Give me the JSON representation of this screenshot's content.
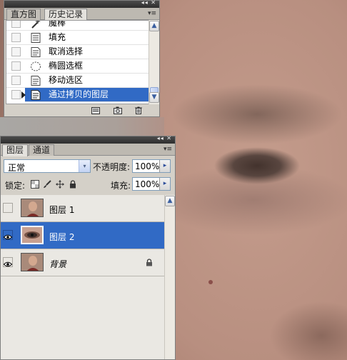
{
  "history_panel": {
    "tabs": [
      {
        "label": "直方图",
        "active": false
      },
      {
        "label": "历史记录",
        "active": true
      }
    ],
    "title_controls": "◂◂ ✕",
    "menu_glyph": "▾≡",
    "items": [
      {
        "label": "魔棒",
        "icon": "magic-wand-icon",
        "selected": false
      },
      {
        "label": "填充",
        "icon": "history-state-icon",
        "selected": false
      },
      {
        "label": "取消选择",
        "icon": "history-state-icon",
        "selected": false
      },
      {
        "label": "椭圆选框",
        "icon": "elliptical-marquee-icon",
        "selected": false
      },
      {
        "label": "移动选区",
        "icon": "history-state-icon",
        "selected": false
      },
      {
        "label": "通过拷贝的图层",
        "icon": "history-state-icon",
        "selected": true
      }
    ],
    "scroll_up": "▲",
    "scroll_down": "▼",
    "footer_icons": [
      "new-document-from-state-icon",
      "snapshot-camera-icon",
      "trash-icon"
    ]
  },
  "layers_panel": {
    "tabs": [
      {
        "label": "图层",
        "active": true
      },
      {
        "label": "通道",
        "active": false
      }
    ],
    "title_controls": "◂◂ ✕",
    "menu_glyph": "▾≡",
    "blend_mode": "正常",
    "opacity_label": "不透明度:",
    "opacity_value": "100%",
    "lock_label": "锁定:",
    "lock_icons": [
      "lock-transparent-pixels-icon",
      "lock-image-pixels-icon",
      "lock-position-icon",
      "lock-all-icon"
    ],
    "fill_label": "填充:",
    "fill_value": "100%",
    "stepper_glyph": "▸",
    "dropdown_glyph": "▾",
    "layers": [
      {
        "name": "图层 1",
        "visible": false,
        "selected": false,
        "italic": false,
        "locked": false,
        "thumb": "portrait"
      },
      {
        "name": "图层 2",
        "visible": true,
        "selected": true,
        "italic": false,
        "locked": false,
        "thumb": "eye"
      },
      {
        "name": "背景",
        "visible": true,
        "selected": false,
        "italic": true,
        "locked": true,
        "thumb": "portrait"
      }
    ],
    "scroll_up": "▲"
  },
  "colors": {
    "selection": "#316ac5",
    "panel_bg": "#d4d0c8",
    "titlebar": "#3a3a3a"
  }
}
